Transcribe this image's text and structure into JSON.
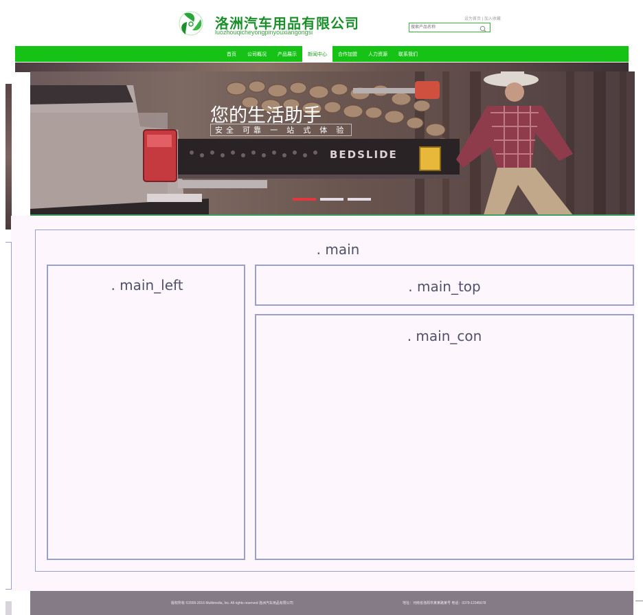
{
  "header": {
    "company_name": "洛洲汽车用品有限公司",
    "company_pinyin": "luozhouqicheyongpinyouxiangongsi",
    "top_link": "设为首页 | 加入收藏",
    "search_placeholder": "搜索产品名称"
  },
  "nav": {
    "items": [
      {
        "label": "首页"
      },
      {
        "label": "公司概况"
      },
      {
        "label": "产品展示"
      },
      {
        "label": "新闻中心",
        "active": true
      },
      {
        "label": "合作加盟"
      },
      {
        "label": "人力资源"
      },
      {
        "label": "联系我们"
      }
    ]
  },
  "banner": {
    "title": "您的生活助手",
    "subtitle": "安全 可靠 一 站 式 体 验",
    "product_text": "BEDSLIDE",
    "slide_count": 3,
    "active_slide": 1
  },
  "layout": {
    "main_label": ". main",
    "main_left_label": ". main_left",
    "main_top_label": ". main_top",
    "main_con_label": ". main_con"
  },
  "footer": {
    "copyright": "版权所有 ©2009-2016 Multimedia, Inc. All rights reserved  洛洲汽车用品有限公司",
    "contact": "地址：河南省洛阳市某某路某号   电话：0379-12345678"
  },
  "colors": {
    "brand_green": "#17c217",
    "frame_border": "#9a9fc9",
    "footer_bg": "#857b87",
    "active_dot": "#e0383e"
  }
}
